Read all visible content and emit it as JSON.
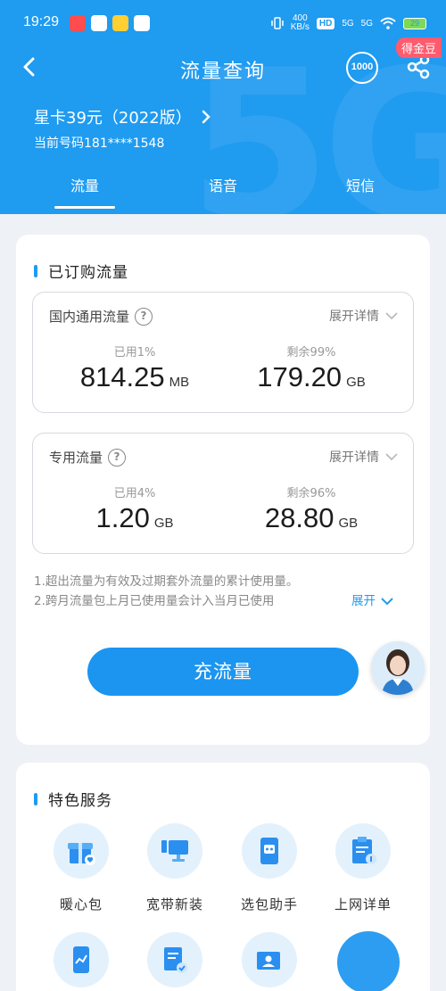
{
  "status_bar": {
    "time": "19:29",
    "speed": "400",
    "speed_unit": "KB/s",
    "hd": "HD",
    "net1": "5G",
    "net2": "5G",
    "battery": "29"
  },
  "nav": {
    "title": "流量查询",
    "badge_1000": "1000",
    "coin_badge": "得金豆"
  },
  "plan": {
    "name": "星卡39元（2022版）",
    "phone": "当前号码181****1548"
  },
  "tabs": [
    "流量",
    "语音",
    "短信"
  ],
  "purchased": {
    "title": "已订购流量",
    "domestic": {
      "label": "国内通用流量",
      "expand": "展开详情",
      "used_caption": "已用1%",
      "used_value": "814.25",
      "used_unit": "MB",
      "remain_caption": "剩余99%",
      "remain_value": "179.20",
      "remain_unit": "GB"
    },
    "dedicated": {
      "label": "专用流量",
      "expand": "展开详情",
      "used_caption": "已用4%",
      "used_value": "1.20",
      "used_unit": "GB",
      "remain_caption": "剩余96%",
      "remain_value": "28.80",
      "remain_unit": "GB"
    },
    "note1": "1.超出流量为有效及过期套外流量的累计使用量。",
    "note2": "2.跨月流量包上月已使用量会计入当月已使用",
    "note_more": "展开",
    "recharge": "充流量"
  },
  "services": {
    "title": "特色服务",
    "items": [
      "暖心包",
      "宽带新装",
      "选包助手",
      "上网详单"
    ]
  },
  "colors": {
    "primary": "#1f9bf0",
    "badge": "#ff5b6e"
  }
}
